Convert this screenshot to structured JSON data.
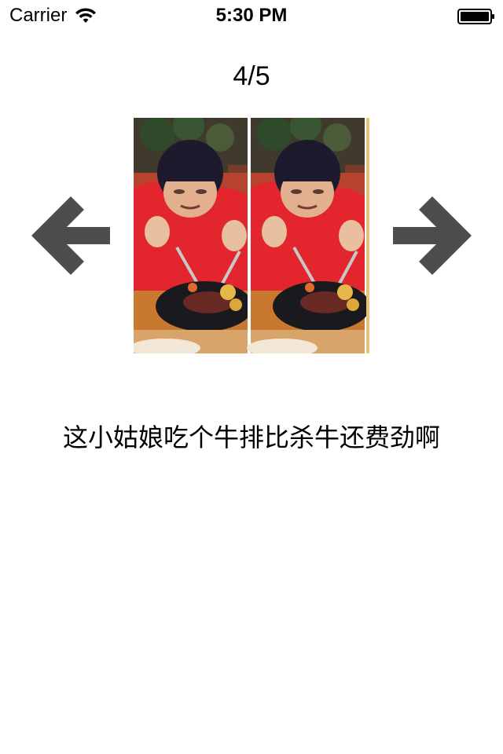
{
  "status_bar": {
    "carrier": "Carrier",
    "time": "5:30 PM",
    "wifi_icon": "wifi-icon",
    "battery_icon": "battery-icon"
  },
  "gallery": {
    "counter": "4/5",
    "caption": "这小姑娘吃个牛排比杀牛还费劲啊",
    "prev_icon": "arrow-left-icon",
    "next_icon": "arrow-right-icon",
    "arrow_color": "#4d4d4f"
  },
  "photo": {
    "description_icon": "photo-image",
    "accent_red": "#e3262d"
  }
}
